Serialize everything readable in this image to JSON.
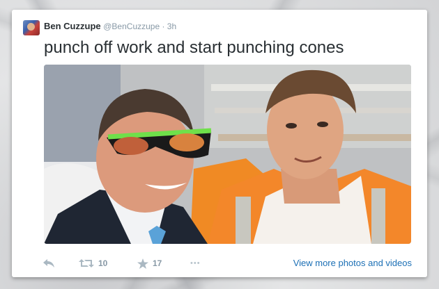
{
  "tweet": {
    "display_name": "Ben Cuzzupe",
    "handle_time": "@BenCuzzupe · 3h",
    "text": "punch off work and start punching cones"
  },
  "actions": {
    "retweet_count": "10",
    "favorite_count": "17",
    "more_label": "•••",
    "media_link": "View more photos and videos"
  },
  "colors": {
    "link": "#1b6fb5",
    "muted": "#8899a6",
    "text": "#292f33"
  },
  "icons": [
    "reply-icon",
    "retweet-icon",
    "star-icon",
    "more-icon"
  ]
}
